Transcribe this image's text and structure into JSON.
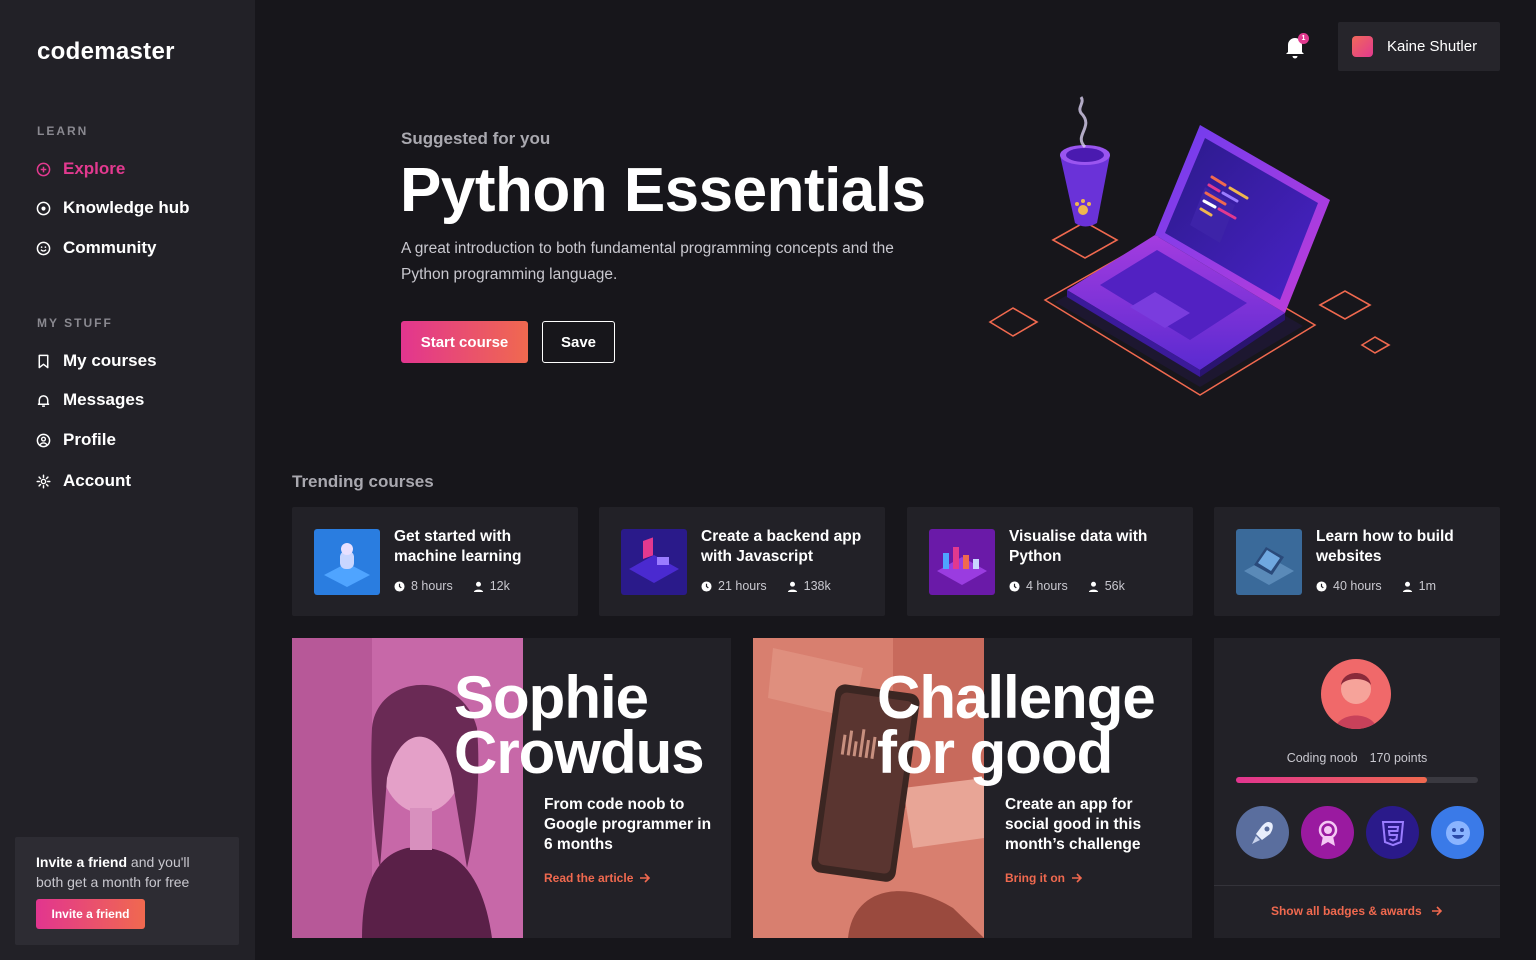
{
  "app": {
    "logo": "codemaster"
  },
  "sidebar": {
    "learn_heading": "LEARN",
    "learn_items": [
      {
        "label": "Explore",
        "icon": "plus-circle-icon",
        "active": true
      },
      {
        "label": "Knowledge hub",
        "icon": "target-icon"
      },
      {
        "label": "Community",
        "icon": "smiley-icon"
      }
    ],
    "mystuff_heading": "MY STUFF",
    "mystuff_items": [
      {
        "label": "My courses",
        "icon": "bookmark-icon"
      },
      {
        "label": "Messages",
        "icon": "bell-icon"
      },
      {
        "label": "Profile",
        "icon": "user-circle-icon"
      },
      {
        "label": "Account",
        "icon": "gear-icon"
      }
    ],
    "invite": {
      "bold": "Invite a friend",
      "text": " and you'll both get a month for free",
      "button": "Invite a friend"
    }
  },
  "topbar": {
    "notification_count": "1",
    "user_name": "Kaine Shutler"
  },
  "hero": {
    "kicker": "Suggested for you",
    "title": "Python Essentials",
    "description": "A great introduction to both fundamental programming concepts and the Python programming language.",
    "start_label": "Start course",
    "save_label": "Save"
  },
  "trending": {
    "title": "Trending courses",
    "courses": [
      {
        "title": "Get started with machine learning",
        "hours": "8 hours",
        "learners": "12k"
      },
      {
        "title": "Create a backend app with Javascript",
        "hours": "21 hours",
        "learners": "138k"
      },
      {
        "title": "Visualise data with Python",
        "hours": "4 hours",
        "learners": "56k"
      },
      {
        "title": "Learn how to build websites",
        "hours": "40 hours",
        "learners": "1m"
      }
    ]
  },
  "features": [
    {
      "big": "Sophie\nCrowdus",
      "sub": "From code noob to Google programmer in 6 months",
      "link": "Read the article"
    },
    {
      "big": "Challenge\nfor good",
      "sub": "Create an app for social good in this month’s challenge",
      "link": "Bring it on"
    }
  ],
  "badges": {
    "rank": "Coding noob",
    "points": "170 points",
    "progress": 0.79,
    "items": [
      "rocket-badge-icon",
      "award-badge-icon",
      "html5-badge-icon",
      "smiley-badge-icon"
    ],
    "link": "Show all badges & awards"
  },
  "colors": {
    "accent": "#e2398f",
    "accent2": "#f0694f",
    "bg": "#17161b",
    "panel": "#222127"
  }
}
